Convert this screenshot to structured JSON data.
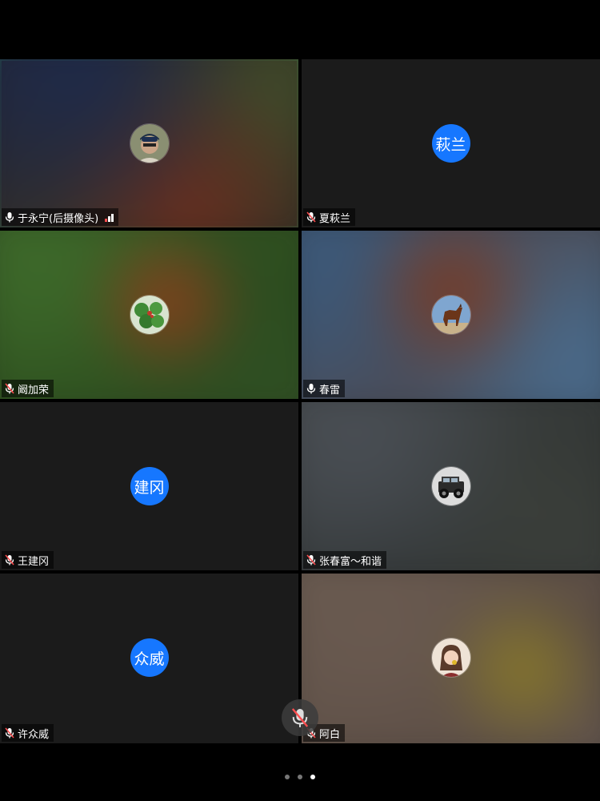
{
  "participants": [
    {
      "name": "于永宁(后摄像头)",
      "initials": "",
      "avatar": "person-photo",
      "mic": "on",
      "active": true,
      "has_signal": true
    },
    {
      "name": "夏萩兰",
      "initials": "萩兰",
      "avatar": "",
      "mic": "muted",
      "active": false
    },
    {
      "name": "阚加荣",
      "initials": "",
      "avatar": "plant-photo",
      "mic": "muted",
      "active": false
    },
    {
      "name": "春雷",
      "initials": "",
      "avatar": "horse-photo",
      "mic": "on",
      "active": false
    },
    {
      "name": "王建冈",
      "initials": "建冈",
      "avatar": "",
      "mic": "muted",
      "active": false
    },
    {
      "name": "张春富～和谐",
      "initials": "",
      "avatar": "jeep-photo",
      "mic": "muted",
      "active": false
    },
    {
      "name": "许众威",
      "initials": "众威",
      "avatar": "",
      "mic": "muted",
      "active": false
    },
    {
      "name": "阿白",
      "initials": "",
      "avatar": "girl-photo",
      "mic": "muted",
      "active": false
    }
  ],
  "colors": {
    "accent": "#1677ff",
    "active_border": "#2fbf71",
    "muted_red": "#ff4d4f"
  },
  "pagination": {
    "pages": 3,
    "current": 3
  },
  "floating_control": {
    "icon": "mic-muted-icon"
  }
}
